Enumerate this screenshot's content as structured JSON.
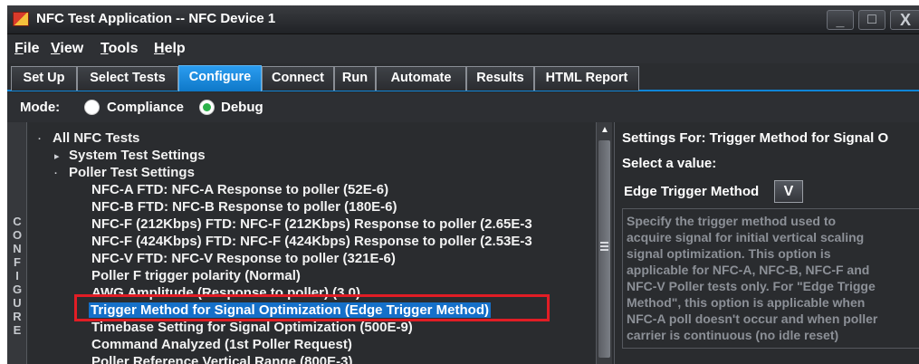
{
  "window": {
    "title": "NFC Test Application -- NFC Device 1",
    "controls": {
      "minimize": "_",
      "maximize": "□",
      "close": "X"
    }
  },
  "menu": [
    {
      "label_rest": "ile",
      "accel": "F"
    },
    {
      "label_rest": "iew",
      "accel": "V"
    },
    {
      "label_rest": "ools",
      "accel": "T"
    },
    {
      "label_rest": "elp",
      "accel": "H"
    }
  ],
  "tabs": [
    {
      "label": "Set Up"
    },
    {
      "label": "Select Tests"
    },
    {
      "label": "Configure",
      "active": true
    },
    {
      "label": "Connect"
    },
    {
      "label": "Run"
    },
    {
      "label": "Automate"
    },
    {
      "label": "Results"
    },
    {
      "label": "HTML Report"
    }
  ],
  "mode": {
    "label": "Mode:",
    "options": [
      {
        "label": "Compliance",
        "selected": false
      },
      {
        "label": "Debug",
        "selected": true
      }
    ]
  },
  "side_label": "CONFIGURE",
  "tree": [
    {
      "label": "All NFC Tests",
      "caret": "·"
    },
    {
      "label": "System Test Settings",
      "caret": "▸"
    },
    {
      "label": "Poller Test Settings",
      "caret": "·"
    },
    {
      "label": "NFC-A FTD: NFC-A Response to poller (52E-6)"
    },
    {
      "label": "NFC-B FTD: NFC-B Response to poller (180E-6)"
    },
    {
      "label": "NFC-F (212Kbps) FTD: NFC-F (212Kbps) Response to poller (2.65E-3"
    },
    {
      "label": "NFC-F (424Kbps) FTD: NFC-F (424Kbps) Response to poller (2.53E-3"
    },
    {
      "label": "NFC-V FTD: NFC-V Response to poller (321E-6)"
    },
    {
      "label": "Poller F trigger polarity (Normal)"
    },
    {
      "label": "AWG Amplitude (Response to poller) (3.0)"
    },
    {
      "label": "Trigger Method for Signal Optimization (Edge Trigger Method)",
      "selected": true
    },
    {
      "label": "Timebase Setting for Signal Optimization (500E-9)"
    },
    {
      "label": "Command Analyzed (1st Poller Request)"
    },
    {
      "label": "Poller Reference Vertical Range (800E-3)"
    }
  ],
  "settings": {
    "heading": "Settings For: Trigger Method for Signal O",
    "select_label": "Select a value:",
    "value": "Edge Trigger Method",
    "arrow": "V",
    "description_lines": [
      "Specify the trigger method used to",
      "acquire signal for initial vertical scaling",
      "signal optimization. This option is",
      "applicable for NFC-A, NFC-B, NFC-F and",
      "NFC-V Poller tests only. For \"Edge Trigge",
      "Method\", this option is applicable when",
      "NFC-A poll doesn't occur and when poller",
      "carrier is continuous (no idle reset)"
    ]
  },
  "colors": {
    "accent": "#1a88e0",
    "highlight_box": "#e11d25",
    "debug_radio": "#2bb24a",
    "background": "#2a2c2f"
  }
}
